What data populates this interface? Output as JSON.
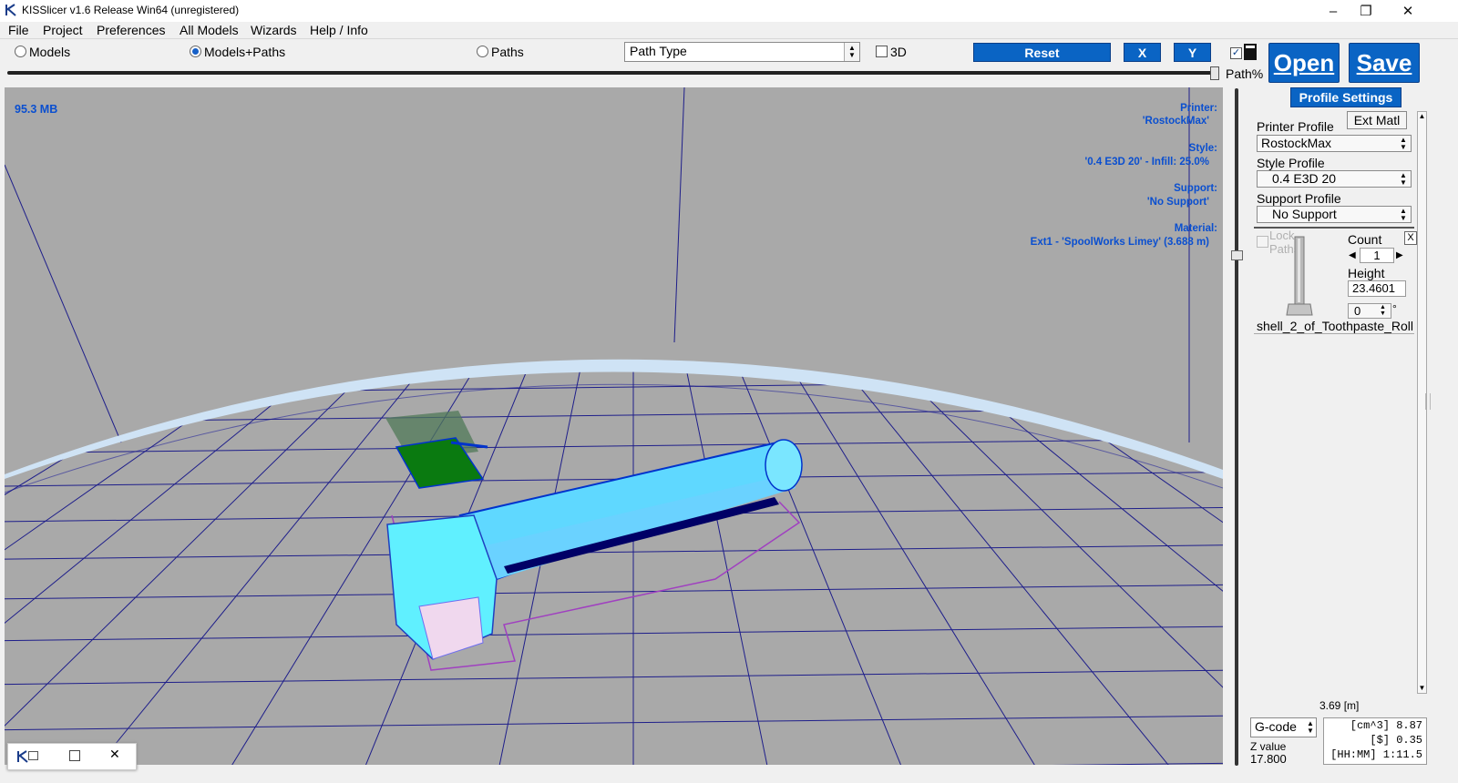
{
  "window": {
    "title": "KISSlicer v1.6 Release  Win64 (unregistered)",
    "minimize_glyph": "–",
    "restore_glyph": "❐",
    "close_glyph": "✕"
  },
  "menu": [
    "File",
    "Project",
    "Preferences",
    "All Models",
    "Wizards",
    "Help / Info"
  ],
  "toolbar": {
    "view_modes": [
      {
        "label": "Models",
        "selected": false
      },
      {
        "label": "Models+Paths",
        "selected": true
      },
      {
        "label": "Paths",
        "selected": false
      }
    ],
    "path_type": {
      "value": "Path Type"
    },
    "three_d": {
      "label": "3D",
      "checked": false
    },
    "reset_label": "Reset",
    "x_label": "X",
    "y_label": "Y",
    "path_percent_label": "Path%",
    "path_percent_checked": true,
    "open_label": "Open",
    "save_label": "Save",
    "profile_settings_label": "Profile Settings",
    "path_slider_fraction": 1.0
  },
  "viewport": {
    "memory": "95.3 MB",
    "printer_label": "Printer:",
    "printer_value": "'RostockMax'",
    "style_label": "Style:",
    "style_value": "'0.4 E3D 20' - Infill: 25.0%",
    "support_label": "Support:",
    "support_value": "'No Support'",
    "material_label": "Material:",
    "material_value": "Ext1 - 'SpoolWorks Limey' (3.688 m)",
    "colors": {
      "background": "#a9a9a9",
      "grid": "#1e1e8a",
      "bed_ring": "#cfe3f5",
      "model": "#60f0ff",
      "infill": "#0a7a10",
      "path": "#0000cc"
    }
  },
  "panel": {
    "ext_matl_label": "Ext Matl",
    "printer_profile_label": "Printer Profile",
    "printer_profile_value": "RostockMax",
    "style_profile_label": "Style Profile",
    "style_profile_value": "0.4 E3D 20",
    "support_profile_label": "Support Profile",
    "support_profile_value": "No Support",
    "model": {
      "lock_paths_label": "Lock Paths",
      "count_label": "Count",
      "count_value": "1",
      "height_label": "Height",
      "height_value": "23.4601",
      "rotation_value": "0",
      "degree_symbol": "°",
      "name": "shell_2_of_Toothpaste_Roll",
      "remove_glyph": "X"
    }
  },
  "footer": {
    "length": "3.69 [m]",
    "output_value": "G-code",
    "z_label": "Z value",
    "z_value": "17.800",
    "stats": [
      "[cm^3] 8.87",
      "[$] 0.35",
      "[HH:MM] 1:11.5"
    ]
  }
}
